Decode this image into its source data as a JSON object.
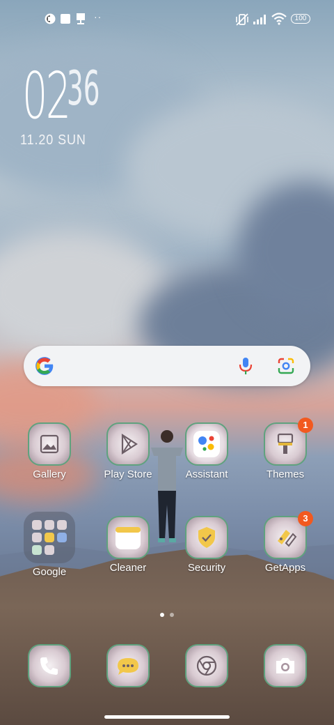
{
  "status_bar": {
    "battery_level": "100",
    "left_icons": [
      "app-notification-icon",
      "square-notification-icon",
      "download-notification-icon",
      "more-notifications-icon"
    ],
    "right_icons": [
      "vibrate-off-icon",
      "signal-icon",
      "wifi-icon",
      "battery-icon"
    ]
  },
  "clock": {
    "hour": "02",
    "minute": "36",
    "date": "11.20 SUN"
  },
  "search_bar": {
    "icons": [
      "google-g-icon",
      "microphone-icon",
      "google-lens-icon"
    ]
  },
  "apps": [
    {
      "label": "Gallery",
      "icon": "gallery-icon"
    },
    {
      "label": "Play Store",
      "icon": "play-store-icon"
    },
    {
      "label": "Assistant",
      "icon": "assistant-icon"
    },
    {
      "label": "Themes",
      "icon": "themes-brush-icon",
      "badge": "1"
    },
    {
      "label": "Google",
      "icon": "google-folder-icon"
    },
    {
      "label": "Cleaner",
      "icon": "cleaner-icon"
    },
    {
      "label": "Security",
      "icon": "security-shield-icon"
    },
    {
      "label": "GetApps",
      "icon": "getapps-icon",
      "badge": "3"
    }
  ],
  "dock": [
    {
      "icon": "phone-icon"
    },
    {
      "icon": "messages-icon"
    },
    {
      "icon": "chrome-icon"
    },
    {
      "icon": "camera-icon"
    }
  ],
  "page_indicator": {
    "pages": 2,
    "current": 1
  },
  "colors": {
    "badge": "#f2591f",
    "icon_border": "#5fa27e",
    "search_bg": "#f2f3f5"
  }
}
